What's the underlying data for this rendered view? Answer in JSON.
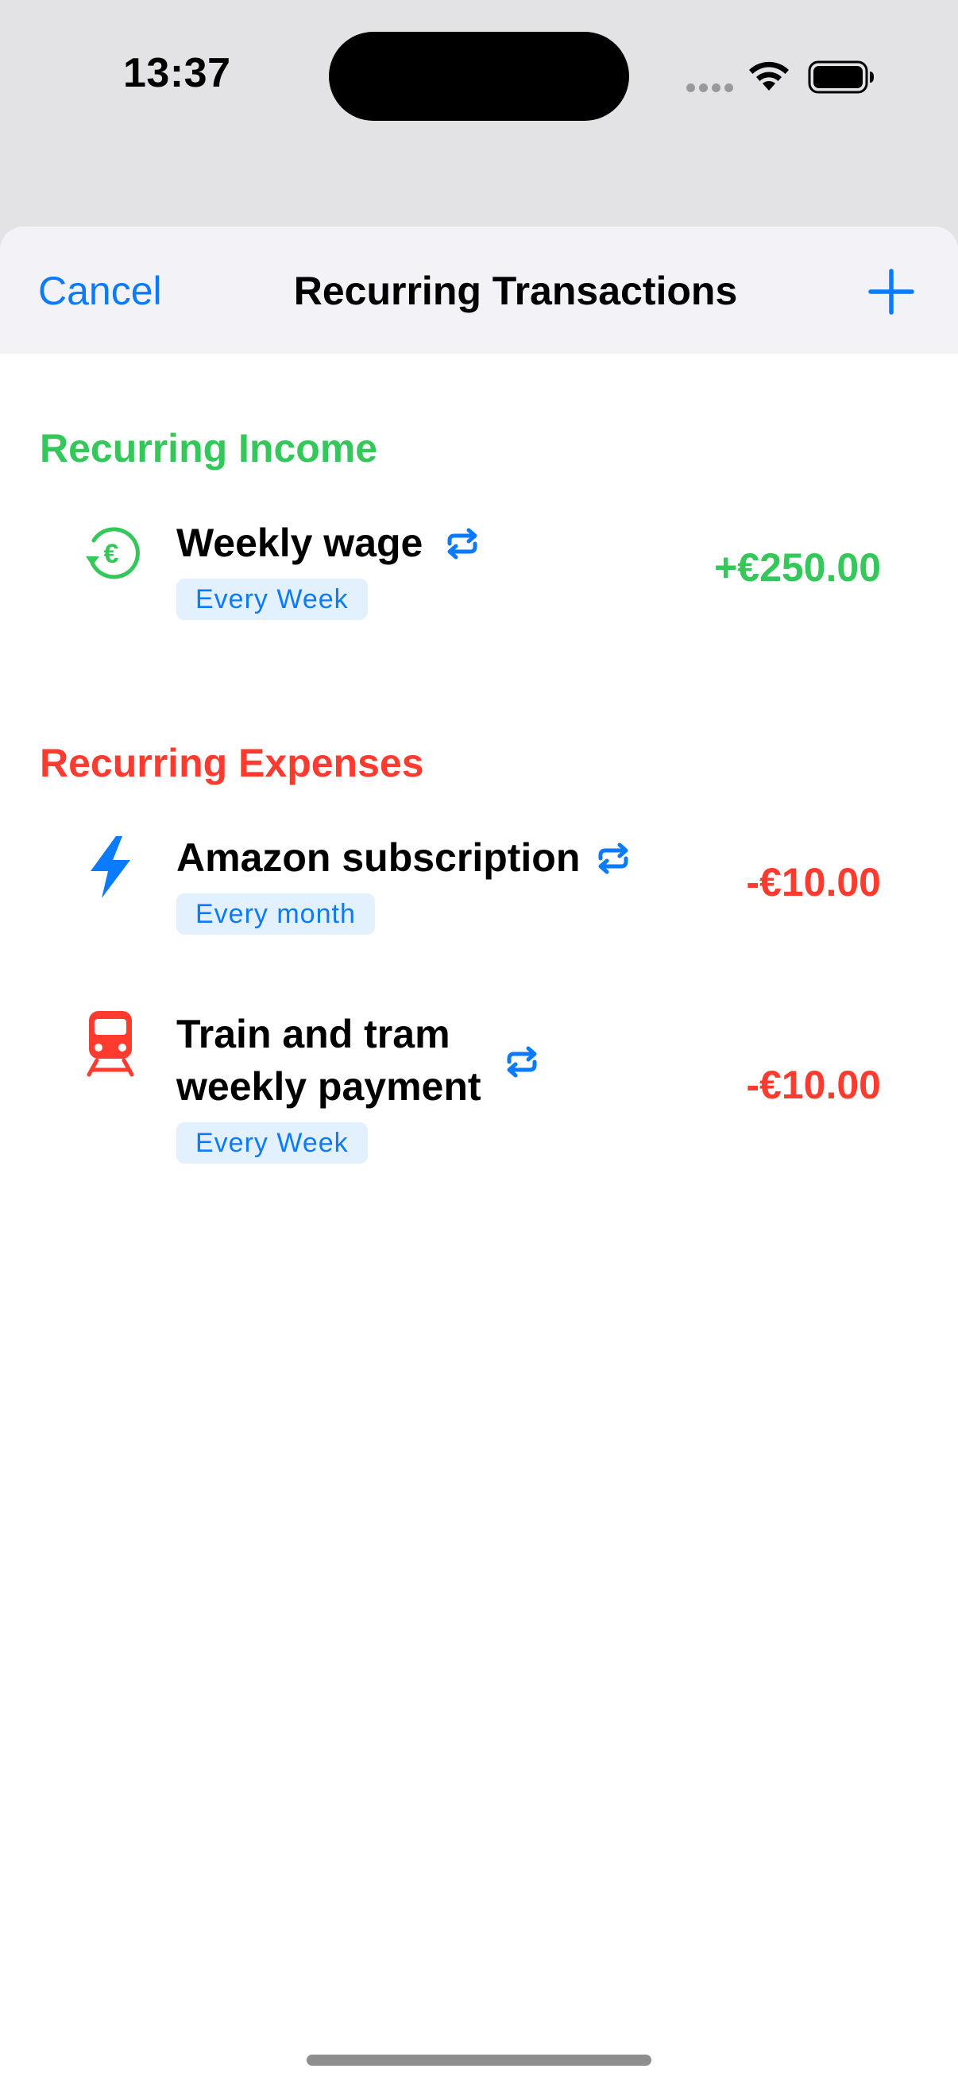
{
  "status_bar": {
    "time": "13:37",
    "icons": [
      "signal-dots-icon",
      "wifi-icon",
      "battery-icon"
    ]
  },
  "nav": {
    "cancel_label": "Cancel",
    "title": "Recurring Transactions",
    "add_icon": "plus-icon"
  },
  "sections": {
    "income": {
      "title": "Recurring Income",
      "color": "#34c759",
      "items": [
        {
          "name": "Weekly wage",
          "frequency": "Every Week",
          "amount": "+€250.00",
          "icon": "euro-refund-icon",
          "repeat_icon": "repeat-icon"
        }
      ]
    },
    "expenses": {
      "title": "Recurring Expenses",
      "color": "#ff3b30",
      "items": [
        {
          "name": "Amazon subscription",
          "frequency": "Every month",
          "amount": "-€10.00",
          "icon": "lightning-bolt-icon",
          "repeat_icon": "repeat-icon"
        },
        {
          "name_line1": "Train and tram",
          "name_line2": "weekly payment",
          "frequency": "Every Week",
          "amount": "-€10.00",
          "icon": "train-icon",
          "repeat_icon": "repeat-icon"
        }
      ]
    }
  },
  "colors": {
    "accent": "#0a7aff",
    "income": "#34c759",
    "expense": "#ff3b30",
    "badge_bg": "#e3f0fd"
  }
}
